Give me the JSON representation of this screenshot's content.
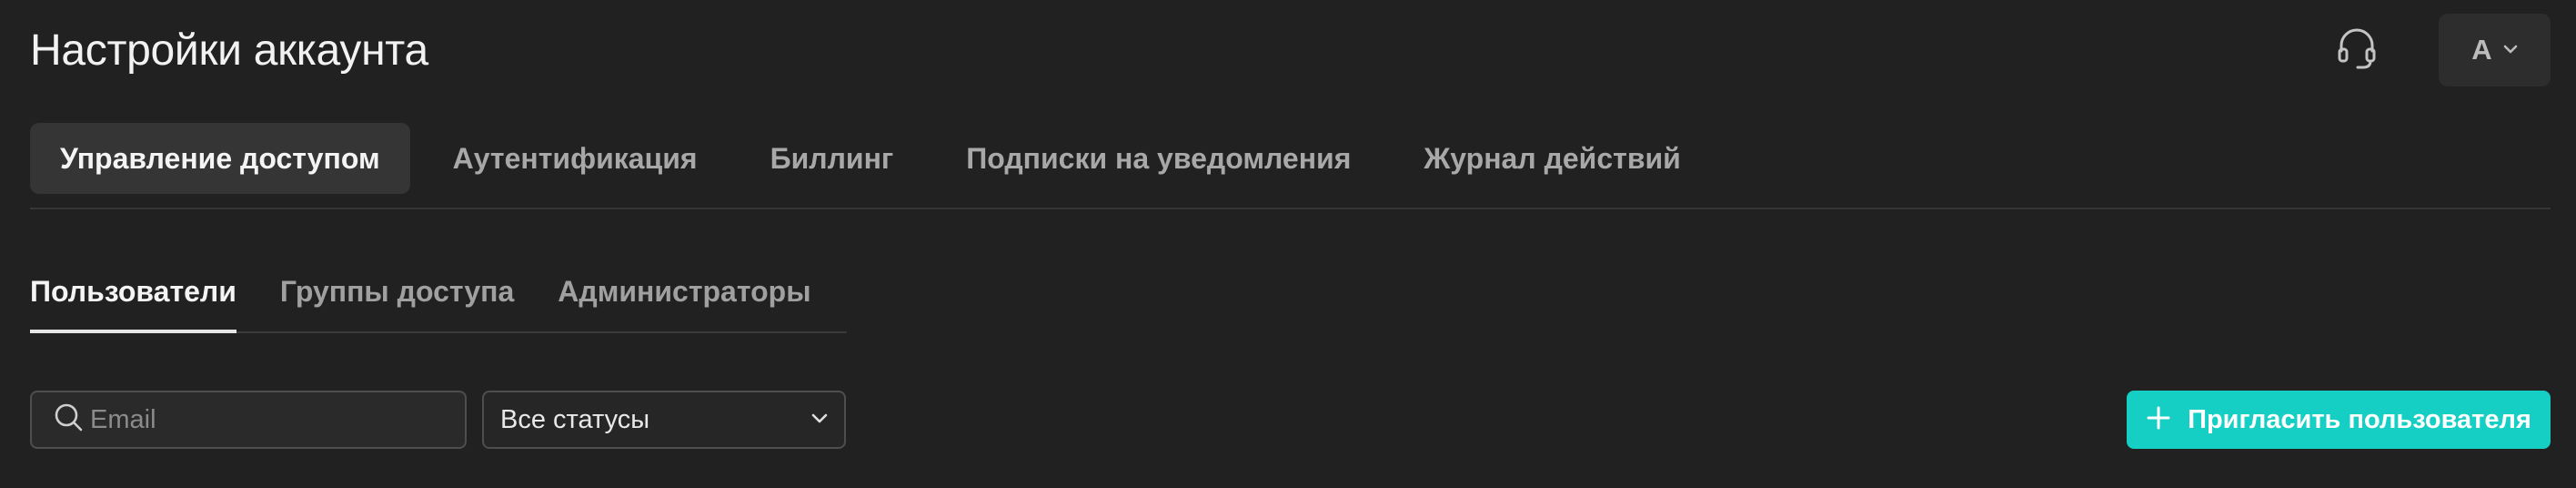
{
  "header": {
    "title": "Настройки аккаунта",
    "support_icon": "headset-icon",
    "account_initial": "A",
    "account_chevron_icon": "chevron-down-icon"
  },
  "main_tabs": [
    {
      "label": "Управление доступом",
      "active": true
    },
    {
      "label": "Аутентификация",
      "active": false
    },
    {
      "label": "Биллинг",
      "active": false
    },
    {
      "label": "Подписки на уведомления",
      "active": false
    },
    {
      "label": "Журнал действий",
      "active": false
    }
  ],
  "sub_tabs": [
    {
      "label": "Пользователи",
      "active": true
    },
    {
      "label": "Группы доступа",
      "active": false
    },
    {
      "label": "Администраторы",
      "active": false
    }
  ],
  "filters": {
    "search": {
      "placeholder": "Email",
      "value": "",
      "icon": "search-icon"
    },
    "status_select": {
      "selected": "Все статусы",
      "icon": "chevron-down-icon"
    }
  },
  "actions": {
    "invite_label": "Пригласить пользователя",
    "invite_icon": "plus-icon"
  },
  "colors": {
    "background": "#212121",
    "accent": "#16cfc4",
    "active_tab_bg": "#353535"
  }
}
